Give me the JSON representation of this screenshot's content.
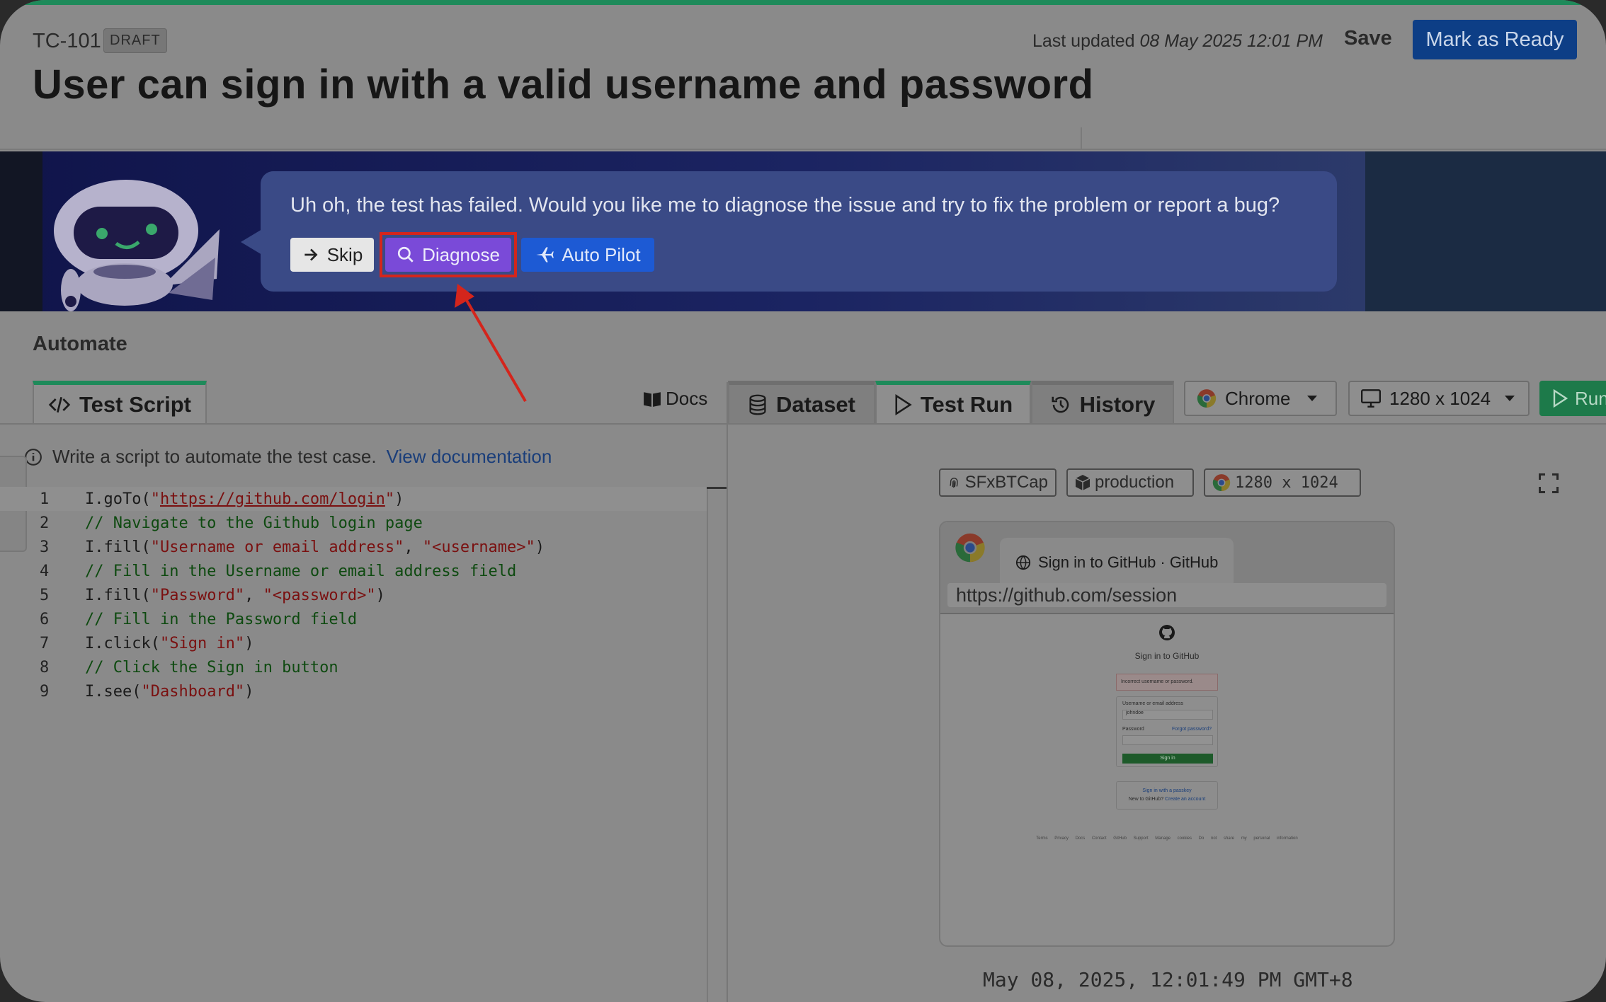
{
  "header": {
    "test_id": "TC-101",
    "status_badge": "DRAFT",
    "last_updated_label": "Last updated",
    "last_updated_value": "08 May 2025 12:01 PM",
    "save_label": "Save",
    "mark_ready_label": "Mark as Ready",
    "title": "User can sign in with a valid username and password"
  },
  "assistant_banner": {
    "message": "Uh oh, the test has failed. Would you like me to diagnose the issue and try to fix the problem or report a bug?",
    "skip_label": "Skip",
    "diagnose_label": "Diagnose",
    "autopilot_label": "Auto Pilot"
  },
  "section_title": "Automate",
  "left_panel": {
    "tab_label": "Test Script",
    "docs_label": "Docs",
    "info_text": "Write a script to automate the test case.",
    "info_link": "View documentation",
    "code_lines": [
      {
        "num": "1",
        "parts": [
          {
            "t": "I.goTo(",
            "c": ""
          },
          {
            "t": "\"",
            "c": "c-str"
          },
          {
            "t": "https://github.com/login",
            "c": "c-url"
          },
          {
            "t": "\"",
            "c": "c-str"
          },
          {
            "t": ")",
            "c": ""
          }
        ]
      },
      {
        "num": "2",
        "parts": [
          {
            "t": "// Navigate to the Github login page",
            "c": "c-com"
          }
        ]
      },
      {
        "num": "3",
        "parts": [
          {
            "t": "I.fill(",
            "c": ""
          },
          {
            "t": "\"Username or email address\"",
            "c": "c-str"
          },
          {
            "t": ", ",
            "c": ""
          },
          {
            "t": "\"<username>\"",
            "c": "c-str"
          },
          {
            "t": ")",
            "c": ""
          }
        ]
      },
      {
        "num": "4",
        "parts": [
          {
            "t": "// Fill in the Username or email address field",
            "c": "c-com"
          }
        ]
      },
      {
        "num": "5",
        "parts": [
          {
            "t": "I.fill(",
            "c": ""
          },
          {
            "t": "\"Password\"",
            "c": "c-str"
          },
          {
            "t": ", ",
            "c": ""
          },
          {
            "t": "\"<password>\"",
            "c": "c-str"
          },
          {
            "t": ")",
            "c": ""
          }
        ]
      },
      {
        "num": "6",
        "parts": [
          {
            "t": "// Fill in the Password field",
            "c": "c-com"
          }
        ]
      },
      {
        "num": "7",
        "parts": [
          {
            "t": "I.click(",
            "c": ""
          },
          {
            "t": "\"Sign in\"",
            "c": "c-str"
          },
          {
            "t": ")",
            "c": ""
          }
        ]
      },
      {
        "num": "8",
        "parts": [
          {
            "t": "// Click the Sign in button",
            "c": "c-com"
          }
        ]
      },
      {
        "num": "9",
        "parts": [
          {
            "t": "I.see(",
            "c": ""
          },
          {
            "t": "\"Dashboard\"",
            "c": "c-str"
          },
          {
            "t": ")",
            "c": ""
          }
        ]
      }
    ]
  },
  "right_panel": {
    "tabs": [
      {
        "label": "Dataset",
        "icon": "database-icon"
      },
      {
        "label": "Test Run",
        "icon": "play-icon"
      },
      {
        "label": "History",
        "icon": "history-icon"
      }
    ],
    "browser_select": "Chrome",
    "resolution_select": "1280 x 1024",
    "run_label": "Run",
    "chips": {
      "run_id": "SFxBTCap",
      "environment": "production",
      "resolution": "1280 x 1024"
    },
    "preview": {
      "tab_title": "Sign in to GitHub · GitHub",
      "url": "https://github.com/session",
      "page_title": "Sign in to GitHub",
      "error": "Incorrect username or password.",
      "username_label": "Username or email address",
      "username_value": "johndoe",
      "password_label": "Password",
      "forgot": "Forgot password?",
      "signin_button": "Sign in",
      "passkey": "Sign in with a passkey",
      "new_to": "New to GitHub?",
      "create": "Create an account",
      "footer": "Terms Privacy Docs Contact GitHub Support Manage cookies Do not share my personal information"
    },
    "timestamp": "May 08, 2025, 12:01:49 PM GMT+8"
  },
  "colors": {
    "accent_green": "#1e8a5a",
    "mark_ready_blue": "#0d3e86",
    "diagnose_purple": "#7a4ad8",
    "autopilot_blue": "#1d5ad4",
    "highlight_red": "#d4251c"
  }
}
